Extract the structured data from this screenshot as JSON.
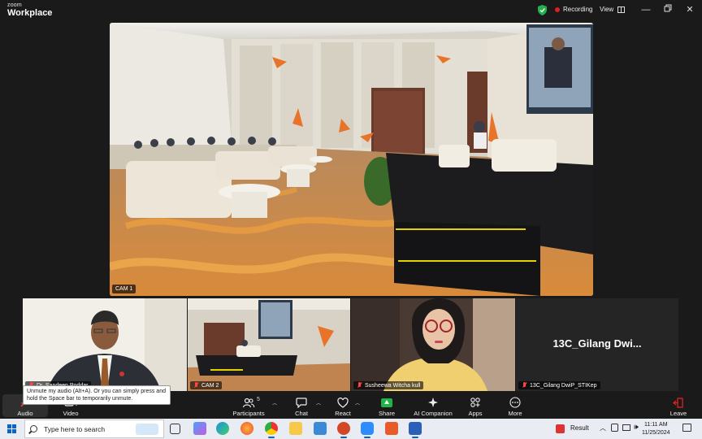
{
  "window": {
    "brand_top": "zoom",
    "brand_name": "Workplace",
    "recording_label": "Recording",
    "view_label": "View"
  },
  "main_video": {
    "label": "CAM 1"
  },
  "thumbnails": [
    {
      "name": "Dr. Sandeep Poddar"
    },
    {
      "name": "CAM 2"
    },
    {
      "name": "Susheewa Witcha kull"
    },
    {
      "name": "13C_Gilang DwiP_STIKep",
      "display_text": "13C_Gilang  Dwi..."
    }
  ],
  "tooltip": "Unmute my audio (Alt+A). Or you can simply press and hold the Space bar to temporarily unmute.",
  "toolbar": {
    "audio": "Audio",
    "video": "Video",
    "participants": "Participants",
    "participants_count": "5",
    "chat": "Chat",
    "react": "React",
    "share": "Share",
    "ai_companion": "AI Companion",
    "apps": "Apps",
    "more": "More",
    "leave": "Leave"
  },
  "taskbar": {
    "search_placeholder": "Type here to search",
    "weather": "Result",
    "time": "11:11 AM",
    "date": "11/25/2024"
  },
  "colors": {
    "accent_share": "#20b447",
    "recording": "#e02020",
    "muted": "#ff4545",
    "leave": "#e02020"
  }
}
